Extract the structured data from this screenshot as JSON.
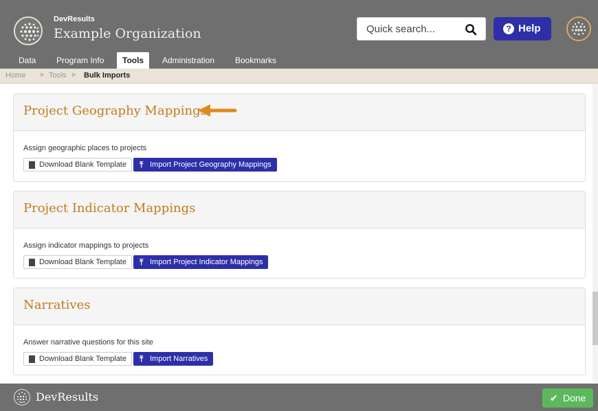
{
  "header": {
    "org_small": "DevResults",
    "org_name": "Example Organization",
    "search_placeholder": "Quick search...",
    "help_label": "Help",
    "nav": [
      "Data",
      "Program Info",
      "Tools",
      "Administration",
      "Bookmarks"
    ],
    "active_nav": "Tools"
  },
  "breadcrumb": [
    "Home",
    "Tools",
    "Bulk Imports"
  ],
  "sections": [
    {
      "title": "Project Geography Mappings",
      "description": "Assign geographic places to projects",
      "download_label": "Download Blank Template",
      "import_label": "Import Project Geography Mappings"
    },
    {
      "title": "Project Indicator Mappings",
      "description": "Assign indicator mappings to projects",
      "download_label": "Download Blank Template",
      "import_label": "Import Project Indicator Mappings"
    },
    {
      "title": "Narratives",
      "description": "Answer narrative questions for this site",
      "download_label": "Download Blank Template",
      "import_label": "Import Narratives"
    }
  ],
  "footer": {
    "brand": "DevResults",
    "done_label": "Done"
  },
  "colors": {
    "header_bg": "#6f6f6f",
    "accent_blue": "#2d2fa8",
    "title_orange": "#c27b1e",
    "arrow_orange": "#e08a1b",
    "done_green": "#5cb85c"
  }
}
